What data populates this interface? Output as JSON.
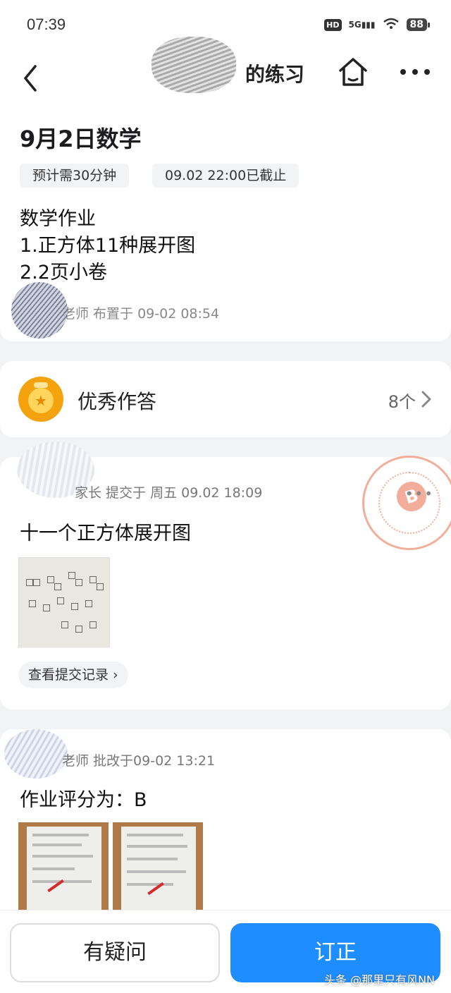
{
  "status_bar": {
    "time": "07:39",
    "hd": "HD",
    "network": "5G",
    "battery": "88"
  },
  "nav": {
    "title": "的练习"
  },
  "homework": {
    "title": "9月2日数学",
    "estimate_tag": "预计需30分钟",
    "deadline_tag": "09.02 22:00已截止",
    "description_lines": [
      "数学作业",
      "1.正方体11种展开图",
      "2.2页小卷"
    ],
    "assigned_by": "老师 布置于 09-02 08:54"
  },
  "excellent": {
    "label": "优秀作答",
    "count": "8个"
  },
  "submission": {
    "meta": "家长 提交于 周五 09.02 18:09",
    "content": "十一个正方体展开图",
    "history_button": "查看提交记录",
    "stamp_grade": "B",
    "more": "•••"
  },
  "review": {
    "meta": "老师 批改于09-02 13:21",
    "grade_text": "作业评分为：B"
  },
  "bottom": {
    "question_button": "有疑问",
    "correct_button": "订正"
  },
  "watermark": "头条 @那里只有风NN",
  "colors": {
    "primary": "#1e8dff",
    "medal": "#f4a20e",
    "stamp": "#f1a18a"
  }
}
